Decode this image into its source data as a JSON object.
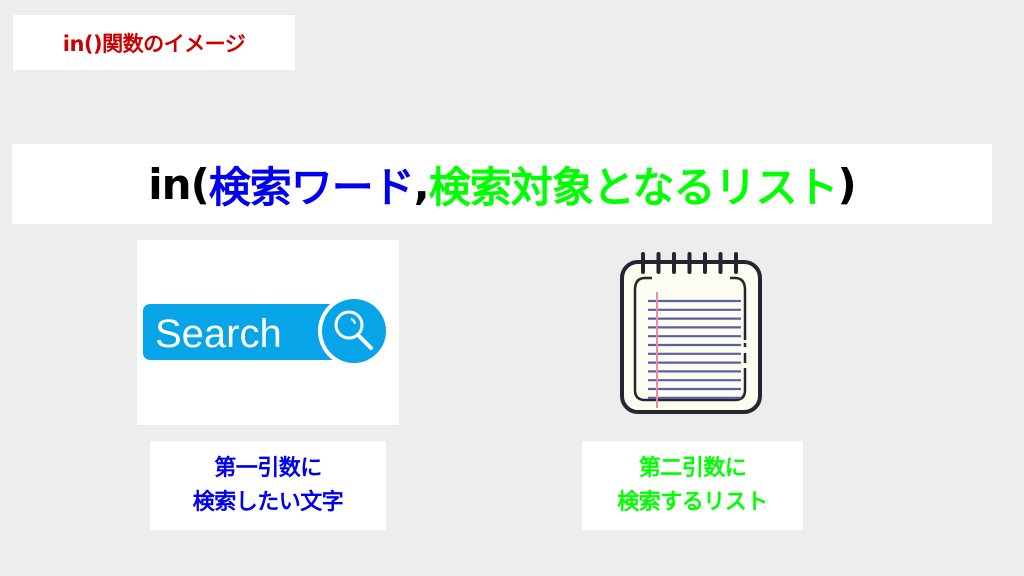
{
  "colors": {
    "background": "#ededed",
    "box": "#ffffff",
    "top_label": "#cc0000",
    "title_black": "#000000",
    "arg1_blue": "#0000ee",
    "arg2_green": "#00ff00",
    "search_blue": "#08a4e8",
    "notepad_paper": "#fdfcf0",
    "notepad_line": "#5a5fa8",
    "notepad_margin": "#f08aa0",
    "notepad_outline": "#23262e"
  },
  "top_label": {
    "text": "in()関数のイメージ"
  },
  "title": {
    "prefix": "in(",
    "arg1": "検索ワード",
    "comma": ",",
    "arg2": "検索対象となるリスト",
    "suffix": ")"
  },
  "search_image": {
    "text": "Search",
    "icon": "magnifier-icon"
  },
  "notepad_image": {
    "icon": "notepad-icon",
    "ruled_lines": 12,
    "spiral_rings": 7
  },
  "captions": {
    "left": {
      "line1": "第一引数に",
      "line2": "検索したい文字"
    },
    "right": {
      "line1": "第二引数に",
      "line2": "検索するリスト"
    }
  }
}
